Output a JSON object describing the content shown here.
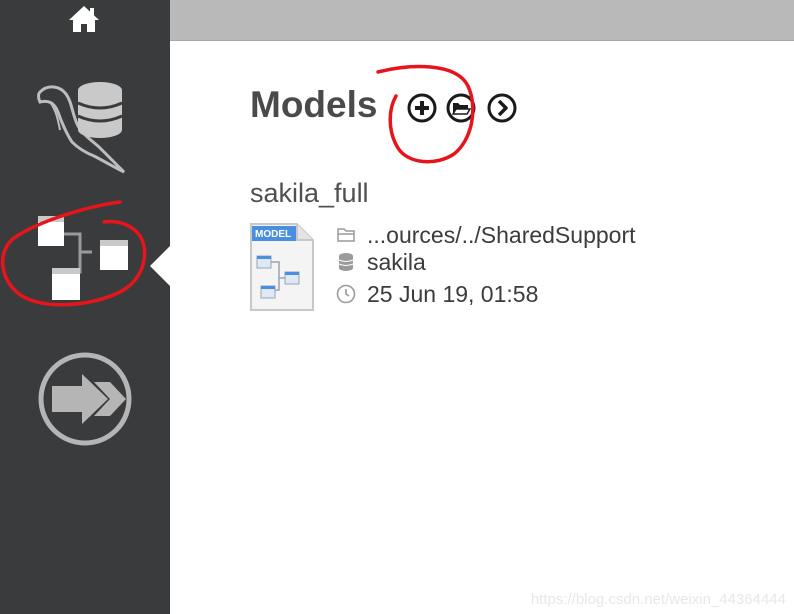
{
  "sidebar": {
    "items": [
      {
        "name": "home",
        "icon": "home-icon"
      },
      {
        "name": "connections",
        "icon": "mysql-dolphin-database-icon"
      },
      {
        "name": "models",
        "icon": "models-diagram-icon",
        "active": true
      },
      {
        "name": "migration",
        "icon": "migration-arrow-icon"
      }
    ]
  },
  "main": {
    "section_title": "Models",
    "header_actions": [
      {
        "name": "add-model",
        "icon": "plus-circle-icon"
      },
      {
        "name": "open-model",
        "icon": "folder-open-icon"
      },
      {
        "name": "browse-models",
        "icon": "chevron-right-circle-icon"
      }
    ],
    "models": [
      {
        "title": "sakila_full",
        "file_badge": "MODEL",
        "path": "...ources/../SharedSupport",
        "schema": "sakila",
        "modified": "25 Jun 19, 01:58"
      }
    ]
  },
  "watermark": "https://blog.csdn.net/weixin_44364444",
  "colors": {
    "sidebar_bg": "#3a3b3d",
    "topbar_bg": "#b9b9b9",
    "annotation_red": "#e8141c",
    "badge_blue": "#4a8ee0"
  }
}
